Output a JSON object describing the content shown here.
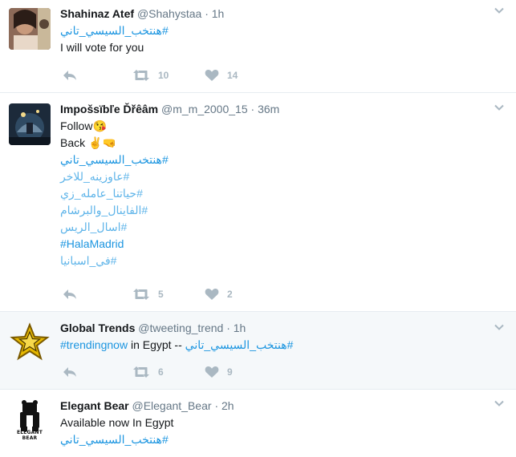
{
  "colors": {
    "link": "#1b95e0",
    "muted": "#657786",
    "icon": "#aab8c2",
    "divider": "#e6ecf0",
    "focused_bg": "#f5f8fa"
  },
  "tweets": [
    {
      "name": "Shahinaz Atef",
      "handle": "@Shahystaa",
      "separator": "·",
      "time": "1h",
      "lines": {
        "hashtag": "#هنتخب_السيسي_تاني",
        "text": "I will vote for you"
      },
      "retweets": "10",
      "likes": "14"
    },
    {
      "name": "Impošsïbľe Ďřêâm",
      "handle": "@m_m_2000_15",
      "separator": "·",
      "time": "36m",
      "lines": {
        "follow": "Follow",
        "follow_emoji": "😘",
        "back": "Back",
        "back_emoji": "✌️🤜",
        "tag1": "#هنتخب_السيسي_تاني",
        "tag2": "#عاوزينه_للاخر",
        "tag3": "#حياتنا_عامله_زي",
        "tag4": "#الفاينال_والبرشام",
        "tag5": "#اسال_الريس",
        "tag6": "#HalaMadrid",
        "tag7": "#في_اسبانيا"
      },
      "retweets": "5",
      "likes": "2"
    },
    {
      "name": "Global Trends",
      "handle": "@tweeting_trend",
      "separator": "·",
      "time": "1h",
      "lines": {
        "tag_a": "#trendingnow",
        "mid": " in Egypt -- ",
        "tag_b": "#هنتخب_السيسي_تاني"
      },
      "retweets": "6",
      "likes": "9"
    },
    {
      "name": "Elegant Bear",
      "handle": "@Elegant_Bear",
      "separator": "·",
      "time": "2h",
      "lines": {
        "text": "Available now In Egypt",
        "hashtag": "#هنتخب_السيسي_تاني"
      },
      "logo_text": "ELEGANT BEAR"
    }
  ],
  "icons": {
    "reply": "reply-icon",
    "retweet": "retweet-icon",
    "like": "heart-icon",
    "more": "chevron-down-icon"
  }
}
